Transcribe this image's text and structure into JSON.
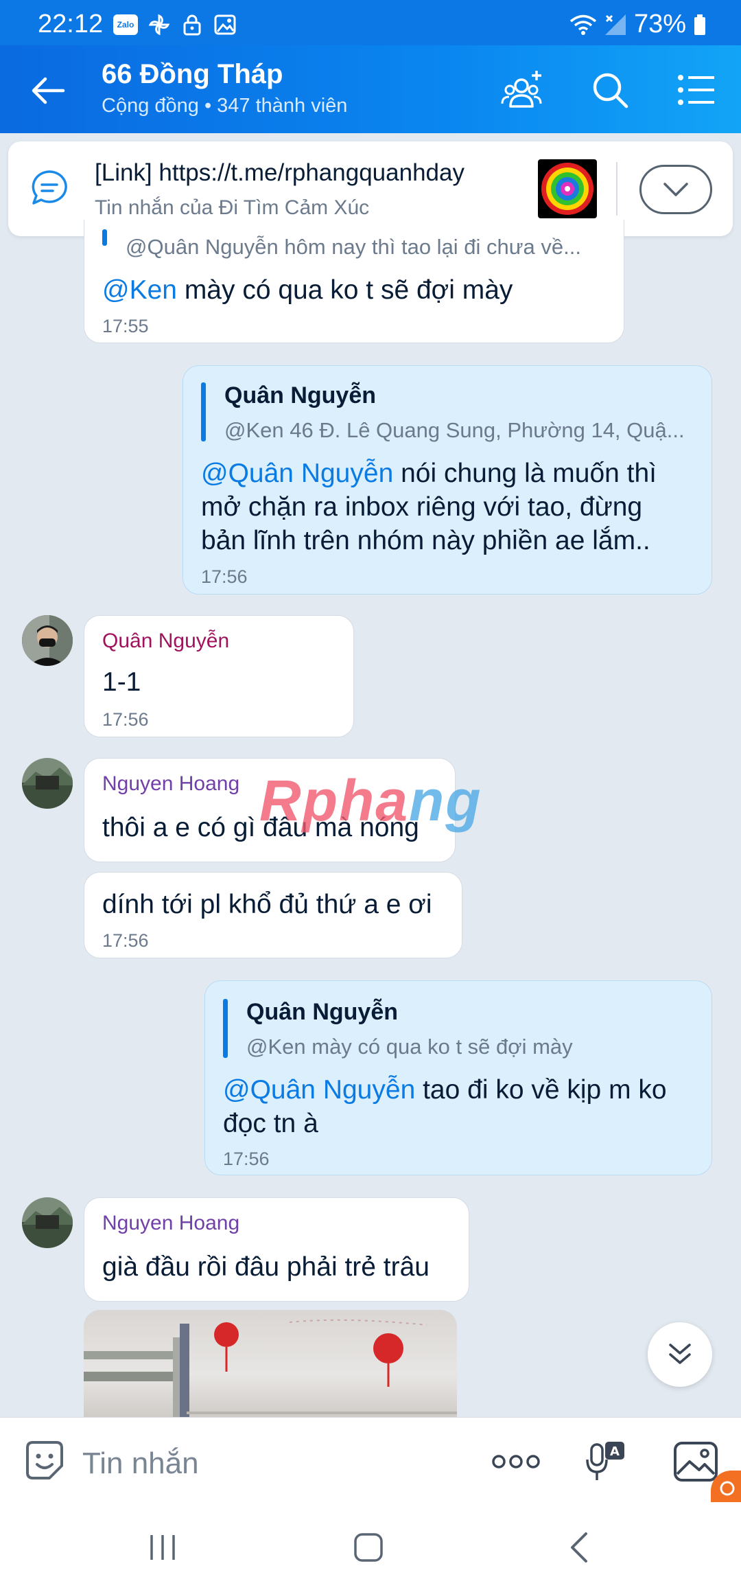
{
  "status_bar": {
    "time": "22:12",
    "zalo_badge": "Zalo",
    "battery": "73%"
  },
  "header": {
    "title": "66 Đồng Tháp",
    "subtitle": "Cộng đồng • 347 thành viên"
  },
  "pinned": {
    "title": "[Link] https://t.me/rphangquanhday",
    "subtitle": "Tin nhắn của Đi Tìm Cảm Xúc"
  },
  "messages": {
    "m1": {
      "quote_text": "@Quân Nguyễn hôm nay thì tao lại đi chưa về...",
      "mention": "@Ken",
      "text": " mày có qua ko t sẽ đợi mày",
      "time": "17:55"
    },
    "m2": {
      "quote_name": "Quân Nguyễn",
      "quote_text": "@Ken 46 Đ. Lê Quang Sung, Phường 14, Quậ...",
      "mention": "@Quân Nguyễn",
      "line1": " nói chung là muốn thì",
      "line2": "mở chặn ra inbox riêng với tao, đừng",
      "line3": "bản lĩnh trên nhóm này phiền ae lắm..",
      "time": "17:56"
    },
    "m3": {
      "sender": "Quân Nguyễn",
      "text": "1-1",
      "time": "17:56"
    },
    "m4": {
      "sender": "Nguyen Hoang",
      "text": "thôi a e có gì đâu mà nóng"
    },
    "m5": {
      "text": "dính tới pl khổ đủ thứ a e ơi",
      "time": "17:56"
    },
    "m6": {
      "quote_name": "Quân Nguyễn",
      "quote_text": "@Ken mày có qua ko t sẽ đợi mày",
      "mention": "@Quân Nguyễn",
      "line1": " tao đi ko về kịp m ko",
      "line2": "đọc tn à",
      "time": "17:56"
    },
    "m7": {
      "sender": "Nguyen Hoang",
      "text": "già đầu rồi đâu phải trẻ trâu"
    }
  },
  "watermark": {
    "part1": "Rpha",
    "part2": "ng"
  },
  "input": {
    "placeholder": "Tin nhắn"
  },
  "colors": {
    "header": "#0a86f0",
    "my_bubble": "#dbeffd",
    "mention": "#0a7be3",
    "sender_quan": "#a0125e",
    "sender_hoang": "#7040a8"
  }
}
